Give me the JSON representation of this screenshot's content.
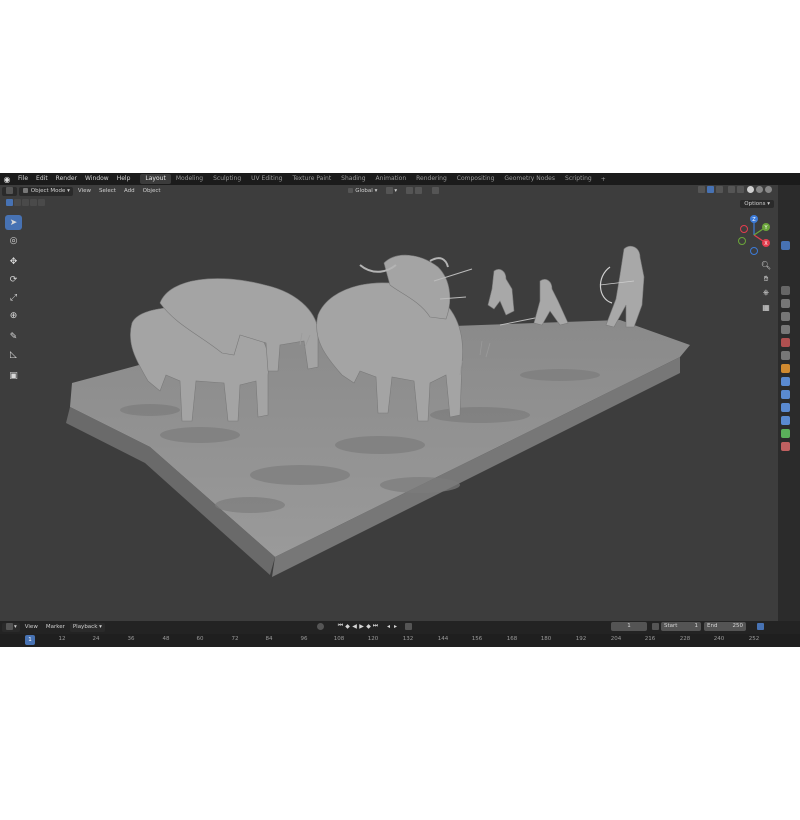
{
  "menubar": {
    "menus": [
      "File",
      "Edit",
      "Render",
      "Window",
      "Help"
    ],
    "workspaces": [
      "Layout",
      "Modeling",
      "Sculpting",
      "UV Editing",
      "Texture Paint",
      "Shading",
      "Animation",
      "Rendering",
      "Compositing",
      "Geometry Nodes",
      "Scripting"
    ],
    "active_workspace": "Layout",
    "add_tab": "+"
  },
  "viewport_header": {
    "mode": "Object Mode",
    "menus": [
      "View",
      "Select",
      "Add",
      "Object"
    ],
    "orientation": "Global",
    "options": "Options"
  },
  "gizmo": {
    "z": "Z",
    "y": "Y",
    "x": "X"
  },
  "timeline": {
    "menus": [
      "View",
      "Marker",
      "Playback"
    ],
    "current_frame": "1",
    "start_label": "Start",
    "start_value": "1",
    "end_label": "End",
    "end_value": "250",
    "ticks": [
      "1",
      "12",
      "24",
      "36",
      "48",
      "60",
      "72",
      "84",
      "96",
      "108",
      "120",
      "132",
      "144",
      "156",
      "168",
      "180",
      "192",
      "204",
      "216",
      "228",
      "240",
      "252"
    ]
  },
  "colors": {
    "accent": "#4772b3",
    "viewport_bg": "#3d3d3d",
    "axis_x": "#e33d4e",
    "axis_y": "#6ba53a",
    "axis_z": "#3d7bd8"
  }
}
